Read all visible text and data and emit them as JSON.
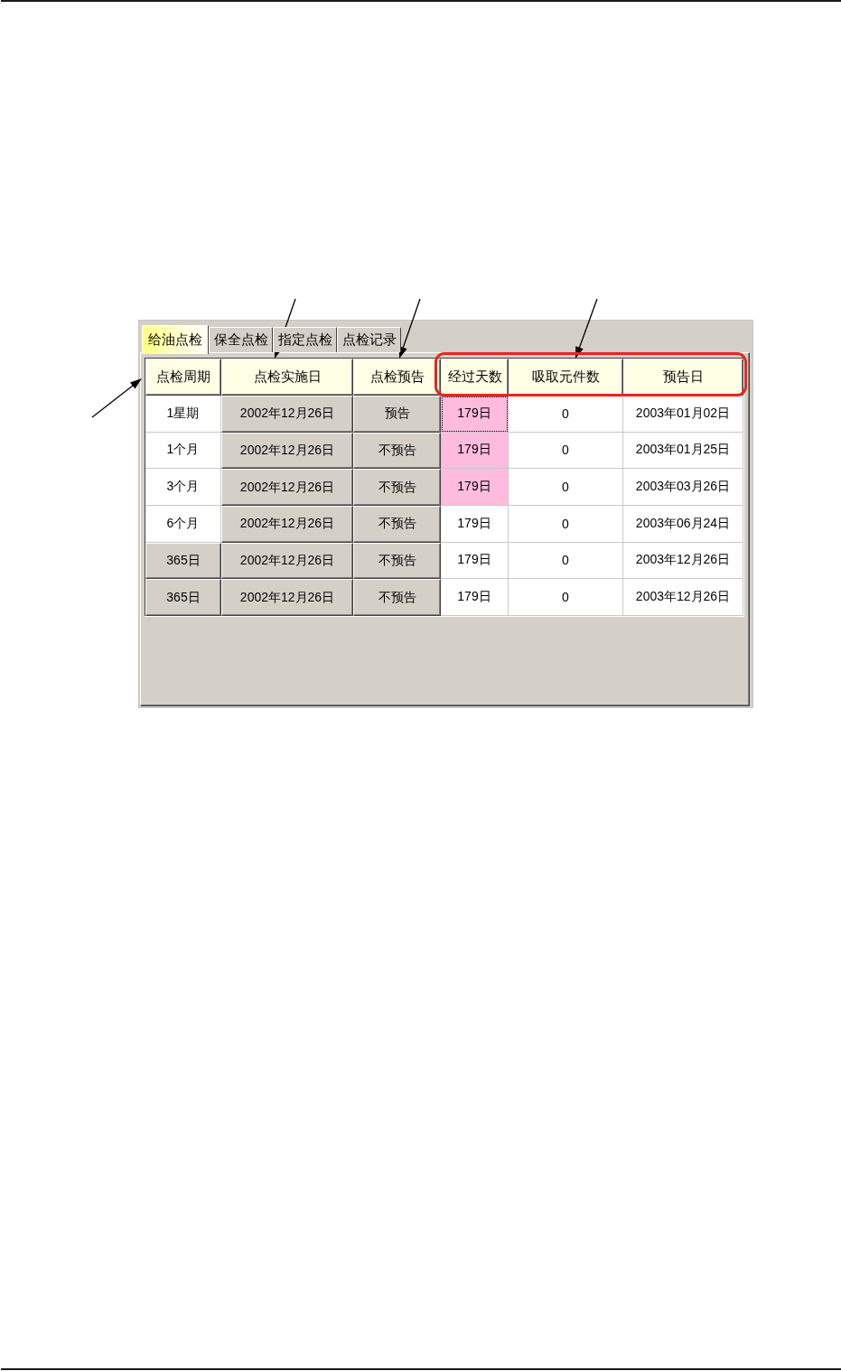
{
  "tabs": [
    {
      "label": "给油点检",
      "selected": true
    },
    {
      "label": "保全点检",
      "selected": false
    },
    {
      "label": "指定点检",
      "selected": false
    },
    {
      "label": "点检记录",
      "selected": false
    }
  ],
  "table": {
    "column_groups": [
      {
        "outlined": false,
        "columns": [
          "点检周期",
          "点检实施日",
          "点检预告"
        ]
      },
      {
        "outlined": true,
        "columns": [
          "经过天数",
          "吸取元件数",
          "预告日"
        ]
      }
    ],
    "rows": [
      {
        "cells": [
          {
            "text": "1星期",
            "kind": "plain",
            "focused": false
          },
          {
            "text": "2002年12月26日",
            "kind": "button",
            "focused": false
          },
          {
            "text": "预告",
            "kind": "button",
            "focused": false
          },
          {
            "text": "179日",
            "kind": "alert",
            "focused": true
          },
          {
            "text": "0",
            "kind": "plain",
            "focused": false
          },
          {
            "text": "2003年01月02日",
            "kind": "plain",
            "focused": false
          }
        ]
      },
      {
        "cells": [
          {
            "text": "1个月",
            "kind": "plain",
            "focused": false
          },
          {
            "text": "2002年12月26日",
            "kind": "button",
            "focused": false
          },
          {
            "text": "不预告",
            "kind": "button",
            "focused": false
          },
          {
            "text": "179日",
            "kind": "alert",
            "focused": false
          },
          {
            "text": "0",
            "kind": "plain",
            "focused": false
          },
          {
            "text": "2003年01月25日",
            "kind": "plain",
            "focused": false
          }
        ]
      },
      {
        "cells": [
          {
            "text": "3个月",
            "kind": "plain",
            "focused": false
          },
          {
            "text": "2002年12月26日",
            "kind": "button",
            "focused": false
          },
          {
            "text": "不预告",
            "kind": "button",
            "focused": false
          },
          {
            "text": "179日",
            "kind": "alert",
            "focused": false
          },
          {
            "text": "0",
            "kind": "plain",
            "focused": false
          },
          {
            "text": "2003年03月26日",
            "kind": "plain",
            "focused": false
          }
        ]
      },
      {
        "cells": [
          {
            "text": "6个月",
            "kind": "plain",
            "focused": false
          },
          {
            "text": "2002年12月26日",
            "kind": "button",
            "focused": false
          },
          {
            "text": "不预告",
            "kind": "button",
            "focused": false
          },
          {
            "text": "179日",
            "kind": "plain",
            "focused": false
          },
          {
            "text": "0",
            "kind": "plain",
            "focused": false
          },
          {
            "text": "2003年06月24日",
            "kind": "plain",
            "focused": false
          }
        ]
      },
      {
        "cells": [
          {
            "text": "365日",
            "kind": "button",
            "focused": false
          },
          {
            "text": "2002年12月26日",
            "kind": "button",
            "focused": false
          },
          {
            "text": "不预告",
            "kind": "button",
            "focused": false
          },
          {
            "text": "179日",
            "kind": "plain",
            "focused": false
          },
          {
            "text": "0",
            "kind": "plain",
            "focused": false
          },
          {
            "text": "2003年12月26日",
            "kind": "plain",
            "focused": false
          }
        ]
      },
      {
        "cells": [
          {
            "text": "365日",
            "kind": "button",
            "focused": false
          },
          {
            "text": "2002年12月26日",
            "kind": "button",
            "focused": false
          },
          {
            "text": "不预告",
            "kind": "button",
            "focused": false
          },
          {
            "text": "179日",
            "kind": "plain",
            "focused": false
          },
          {
            "text": "0",
            "kind": "plain",
            "focused": false
          },
          {
            "text": "2003年12月26日",
            "kind": "plain",
            "focused": false
          }
        ]
      }
    ]
  }
}
